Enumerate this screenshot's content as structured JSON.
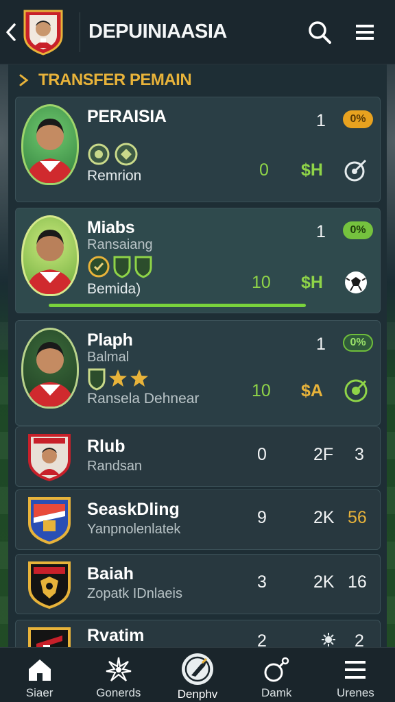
{
  "header": {
    "title": "DEPUINIAASIA"
  },
  "section": {
    "title": "TRANSFER PEMAIN"
  },
  "players": [
    {
      "name": "PERAISIA",
      "subtitle": "",
      "description": "Remrion",
      "rank": "1",
      "pill": "0%",
      "value": "0",
      "price": "$H",
      "action_icon": "whistle-icon"
    },
    {
      "name": "Miabs",
      "subtitle": "Ransaiang",
      "description": "Bemida)",
      "rank": "1",
      "pill": "0%",
      "value": "10",
      "price": "$H",
      "action_icon": "football-icon"
    },
    {
      "name": "Plaph",
      "subtitle": "Balmal",
      "description": "Ransela Dehnear",
      "rank": "1",
      "pill": "0%",
      "value": "10",
      "price": "$A",
      "action_icon": "target-icon"
    }
  ],
  "clubs": [
    {
      "name": "Rlub",
      "subtitle": "Randsan",
      "col1": "0",
      "col2": "2F",
      "col3": "3"
    },
    {
      "name": "SeaskDling",
      "subtitle": "Yanpnolenlatek",
      "col1": "9",
      "col2": "2K",
      "col3": "56"
    },
    {
      "name": "Baiah",
      "subtitle": "Zopatk IDnlaeis",
      "col1": "3",
      "col2": "2K",
      "col3": "16"
    },
    {
      "name": "Rvatim",
      "subtitle": "",
      "col1": "2",
      "col2": "",
      "col3": "2"
    }
  ],
  "nav": [
    {
      "label": "Siaer",
      "icon": "home-icon"
    },
    {
      "label": "Gonerds",
      "icon": "star-burst-icon"
    },
    {
      "label": "Denphv",
      "icon": "boot-icon"
    },
    {
      "label": "Damk",
      "icon": "search-icon"
    },
    {
      "label": "Urenes",
      "icon": "menu-icon"
    }
  ],
  "colors": {
    "accent_gold": "#e8b33a",
    "accent_green": "#8fd448",
    "card_bg": "#2a3e45"
  }
}
